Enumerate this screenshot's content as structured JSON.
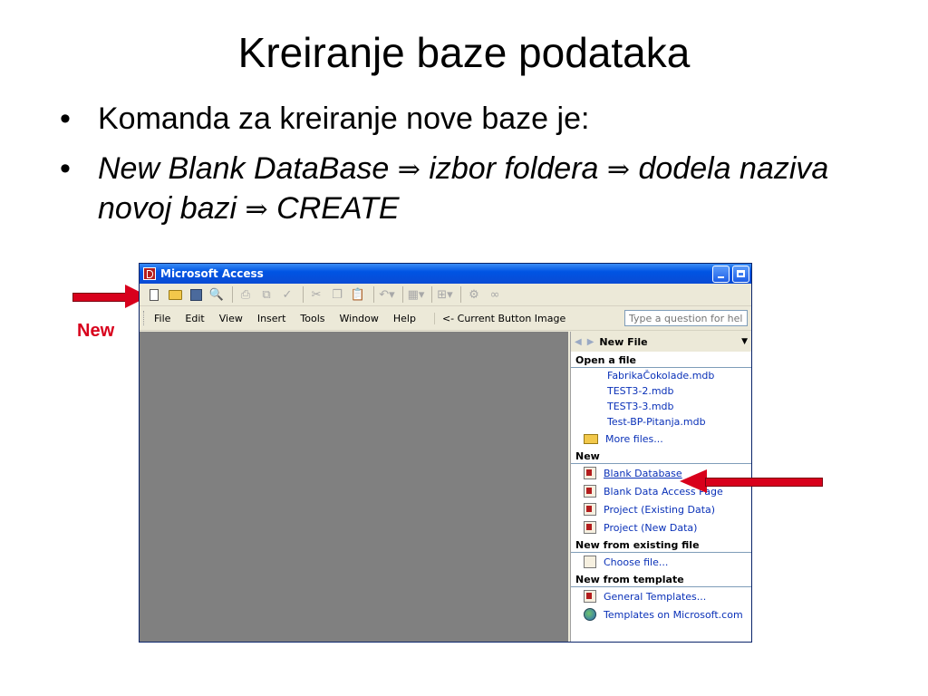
{
  "slide": {
    "title": "Kreiranje baze podataka",
    "bullets": [
      {
        "marker": "•",
        "text": "Komanda za kreiranje nove baze je:"
      },
      {
        "marker": "•",
        "parts": [
          "New Blank DataBase ",
          "⇒",
          " izbor foldera ",
          "⇒",
          " dodela naziva novoj bazi ",
          "⇒",
          " CREATE"
        ]
      }
    ],
    "annotation_label": "New",
    "annotation_color": "#d8001c"
  },
  "window": {
    "title": "Microsoft Access",
    "menu": [
      "File",
      "Edit",
      "View",
      "Insert",
      "Tools",
      "Window",
      "Help"
    ],
    "current_button_image": "<- Current Button Image",
    "help_placeholder": "Type a question for help"
  },
  "toolbar_icons": [
    "new-icon",
    "open-icon",
    "save-icon",
    "search-icon",
    "print-icon",
    "print-preview-icon",
    "spelling-icon",
    "cut-icon",
    "copy-icon",
    "paste-icon",
    "undo-icon",
    "analyze-icon",
    "relationships-icon",
    "office-links-icon",
    "code-icon"
  ],
  "taskpane": {
    "title": "New File",
    "open_a_file": {
      "heading": "Open a file",
      "files": [
        "FabrikaČokolade.mdb",
        "TEST3-2.mdb",
        "TEST3-3.mdb",
        "Test-BP-Pitanja.mdb"
      ],
      "more_files": "More files..."
    },
    "new": {
      "heading": "New",
      "items": [
        "Blank Database",
        "Blank Data Access Page",
        "Project (Existing Data)",
        "Project (New Data)"
      ]
    },
    "new_from_existing": {
      "heading": "New from existing file",
      "items": [
        "Choose file..."
      ]
    },
    "new_from_template": {
      "heading": "New from template",
      "items": [
        "General Templates...",
        "Templates on Microsoft.com"
      ]
    }
  }
}
